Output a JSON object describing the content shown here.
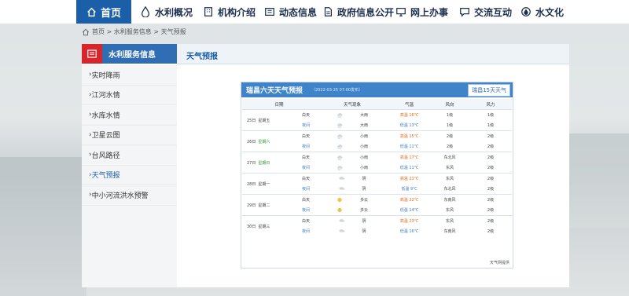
{
  "nav": {
    "home": "首页",
    "items": [
      "水利概况",
      "机构介绍",
      "动态信息",
      "政府信息公开",
      "网上办事",
      "交流互动",
      "水文化"
    ]
  },
  "breadcrumb": "首页 > 水利服务信息 > 天气预报",
  "sidebar": {
    "title": "水利服务信息",
    "items": [
      "实时降雨",
      "江河水情",
      "水库水情",
      "卫星云图",
      "台风路径",
      "天气预报",
      "中小河流洪水预警"
    ]
  },
  "tab_title": "天气预报",
  "weather": {
    "title": "瑞昌六天天气预报",
    "published": "（2022-03-25 07:00发布）",
    "button": "瑞昌15天天气",
    "headers": [
      "日期",
      "天气现象",
      "气温",
      "风向",
      "风力"
    ],
    "footer": "天气网提供",
    "days": [
      {
        "date": "25日",
        "weekday": "星期五",
        "day": {
          "label": "白天",
          "icon": "rain",
          "wx": "大雨",
          "temp_label": "高温",
          "temp": "16℃",
          "wind": "1级",
          "force": "1级"
        },
        "night": {
          "label": "夜间",
          "icon": "rain",
          "wx": "大雨",
          "temp_label": "低温",
          "temp": "13℃",
          "wind": "1级",
          "force": "1级"
        }
      },
      {
        "date": "26日",
        "weekday": "星期六",
        "day": {
          "label": "白天",
          "icon": "rain",
          "wx": "小雨",
          "temp_label": "高温",
          "temp": "15℃",
          "wind": "2级",
          "force": "2级"
        },
        "night": {
          "label": "夜间",
          "icon": "rain",
          "wx": "小雨",
          "temp_label": "低温",
          "temp": "11℃",
          "wind": "2级",
          "force": "2级"
        }
      },
      {
        "date": "27日",
        "weekday": "星期日",
        "day": {
          "label": "白天",
          "icon": "rain",
          "wx": "小雨",
          "temp_label": "高温",
          "temp": "17℃",
          "wind": "东北风",
          "force": "2级"
        },
        "night": {
          "label": "夜间",
          "icon": "rain",
          "wx": "小雨",
          "temp_label": "低温",
          "temp": "11℃",
          "wind": "东风",
          "force": "2级"
        }
      },
      {
        "date": "28日",
        "weekday": "星期一",
        "day": {
          "label": "白天",
          "icon": "cloud",
          "wx": "阴",
          "temp_label": "高温",
          "temp": "21℃",
          "wind": "东风",
          "force": "2级"
        },
        "night": {
          "label": "夜间",
          "icon": "cloud",
          "wx": "阴",
          "temp_label": "低温",
          "temp": "9℃",
          "wind": "东北风",
          "force": "2级"
        }
      },
      {
        "date": "29日",
        "weekday": "星期二",
        "day": {
          "label": "白天",
          "icon": "sun",
          "wx": "多云",
          "temp_label": "高温",
          "temp": "22℃",
          "wind": "东南风",
          "force": "2级"
        },
        "night": {
          "label": "夜间",
          "icon": "sun",
          "wx": "多云",
          "temp_label": "低温",
          "temp": "14℃",
          "wind": "东风",
          "force": "2级"
        }
      },
      {
        "date": "30日",
        "weekday": "星期三",
        "day": {
          "label": "白天",
          "icon": "cloud",
          "wx": "阴",
          "temp_label": "高温",
          "temp": "23℃",
          "wind": "东风",
          "force": "2级"
        },
        "night": {
          "label": "夜间",
          "icon": "cloud",
          "wx": "阴",
          "temp_label": "低温",
          "temp": "16℃",
          "wind": "东南风",
          "force": "2级"
        }
      }
    ]
  }
}
